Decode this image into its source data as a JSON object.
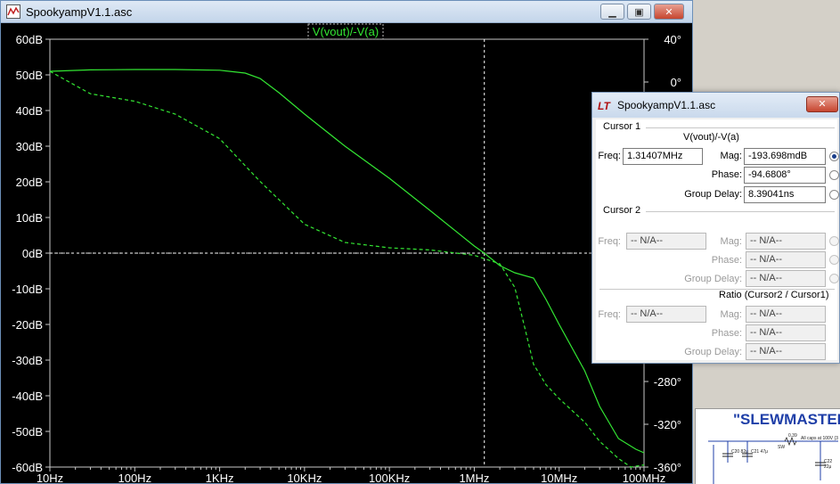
{
  "window": {
    "title": "SpookyampV1.1.asc"
  },
  "plot": {
    "trace_label": "V(vout)/-V(a)",
    "colors": {
      "background": "#000000",
      "trace": "#33e633",
      "axis_text": "#ffffff",
      "grid": "#c8c8c8"
    },
    "left_axis_labels": [
      "60dB",
      "50dB",
      "40dB",
      "30dB",
      "20dB",
      "10dB",
      "0dB",
      "-10dB",
      "-20dB",
      "-30dB",
      "-40dB",
      "-50dB",
      "-60dB"
    ],
    "right_axis_labels": [
      "40°",
      "0°",
      "-280°",
      "-320°",
      "-360°"
    ],
    "x_axis_labels": [
      "10Hz",
      "100Hz",
      "1KHz",
      "10KHz",
      "100KHz",
      "1MHz",
      "10MHz",
      "100MHz"
    ]
  },
  "chart_data": {
    "type": "line",
    "xscale": "log",
    "xlim": [
      10,
      100000000
    ],
    "ylim": [
      -60,
      60
    ],
    "y2lim": [
      -360,
      40
    ],
    "cursor": {
      "x": 1314070,
      "y": 0
    },
    "series": [
      {
        "name": "V(vout)/-V(a)",
        "style": "solid",
        "axis": "magnitude",
        "x": [
          10,
          30,
          100,
          300,
          1000,
          2000,
          3000,
          5000,
          10000,
          30000,
          100000,
          300000,
          1000000,
          1314070,
          2000000,
          3000000,
          5000000,
          7000000,
          10000000,
          20000000,
          30000000,
          50000000,
          80000000,
          100000000
        ],
        "y": [
          51,
          51.4,
          51.5,
          51.5,
          51.3,
          50.5,
          49,
          45,
          39,
          30,
          21,
          12,
          2,
          0,
          -3.5,
          -5.5,
          -7,
          -13,
          -20,
          -33,
          -43,
          -52,
          -55,
          -56
        ]
      },
      {
        "name": "V(vout)/-V(a)",
        "style": "dashed",
        "axis": "phase",
        "x": [
          10,
          30,
          100,
          300,
          1000,
          3000,
          10000,
          30000,
          100000,
          300000,
          1000000,
          2000000,
          3000000,
          4000000,
          5000000,
          7000000,
          10000000,
          20000000,
          30000000,
          50000000,
          70000000,
          100000000
        ],
        "y": [
          10,
          -11,
          -18,
          -30,
          -53,
          -93,
          -133,
          -150,
          -155,
          -157,
          -162,
          -170,
          -192,
          -232,
          -264,
          -283,
          -296,
          -318,
          -336,
          -352,
          -360,
          -358
        ]
      }
    ]
  },
  "cursor_dialog": {
    "title": "SpookyampV1.1.asc",
    "logo": "LT",
    "close": "✕",
    "cursor1": {
      "label": "Cursor 1",
      "trace": "V(vout)/-V(a)",
      "freq_label": "Freq:",
      "freq_value": "1.31407MHz",
      "mag_label": "Mag:",
      "mag_value": "-193.698mdB",
      "phase_label": "Phase:",
      "phase_value": "-94.6808°",
      "gd_label": "Group Delay:",
      "gd_value": "8.39041ns"
    },
    "cursor2": {
      "label": "Cursor 2",
      "freq_label": "Freq:",
      "freq_value": "-- N/A--",
      "mag_label": "Mag:",
      "mag_value": "-- N/A--",
      "phase_label": "Phase:",
      "phase_value": "-- N/A--",
      "gd_label": "Group Delay:",
      "gd_value": "-- N/A--"
    },
    "ratio": {
      "label": "Ratio (Cursor2 / Cursor1)",
      "freq_label": "Freq:",
      "freq_value": "-- N/A--",
      "mag_label": "Mag:",
      "mag_value": "-- N/A--",
      "phase_label": "Phase:",
      "phase_value": "-- N/A--",
      "gd_label": "Group Delay:",
      "gd_value": "-- N/A--"
    }
  },
  "schematic": {
    "title": "\"SLEWMASTER\"",
    "note": "All caps at 100V (3",
    "labels": [
      "C20 82μ",
      "C21 47μ",
      "C22 22μ",
      "SW",
      "0.39"
    ]
  }
}
